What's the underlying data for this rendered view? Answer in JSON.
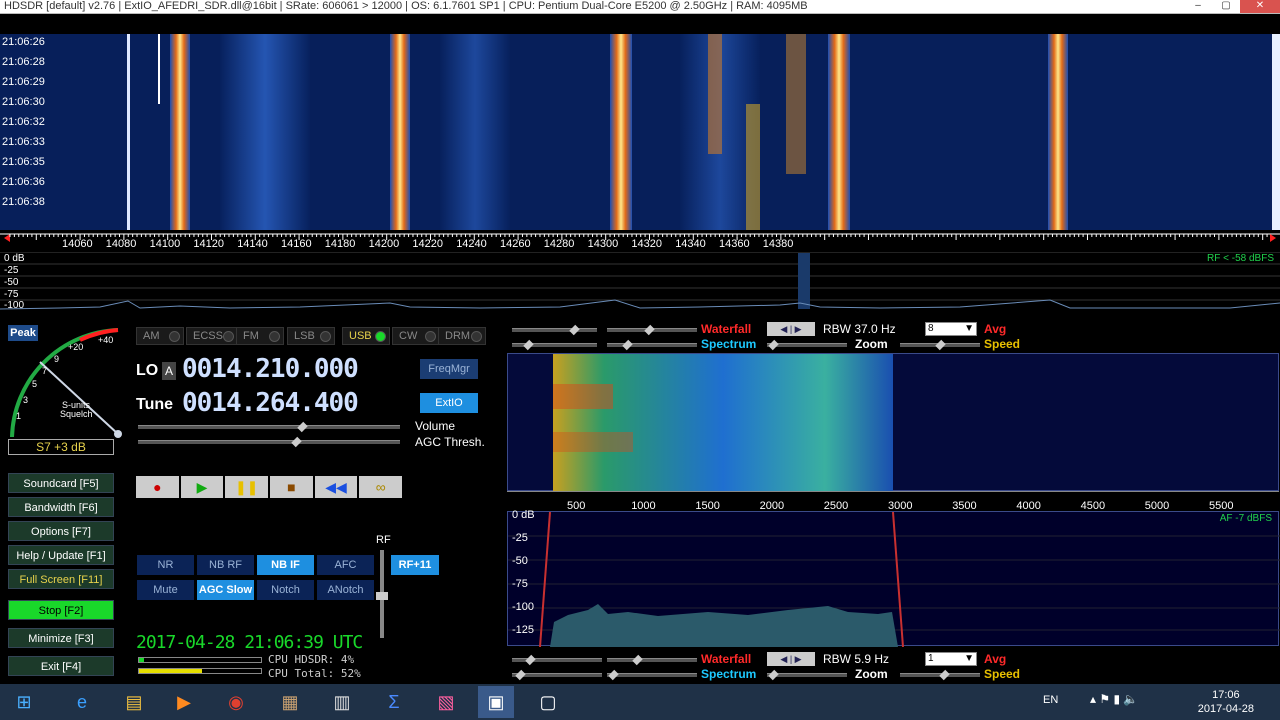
{
  "titlebar": {
    "text": "HDSDR  [default]  v2.76    |   ExtIO_AFEDRI_SDR.dll@16bit   |  SRate: 606061 > 12000   |  OS: 6.1.7601 SP1   |  CPU: Pentium Dual-Core          E5200  @ 2.50GHz  |  RAM: 4095MB",
    "min": "–",
    "max": "▢",
    "close": "✕"
  },
  "times": [
    "21:06:26",
    "21:06:28",
    "21:06:29",
    "21:06:30",
    "21:06:32",
    "21:06:33",
    "21:06:35",
    "21:06:36",
    "21:06:38"
  ],
  "freqs": [
    "14060",
    "14080",
    "14100",
    "14120",
    "14140",
    "14160",
    "14180",
    "14200",
    "14220",
    "14240",
    "14260",
    "14280",
    "14300",
    "14320",
    "14340",
    "14360",
    "14380"
  ],
  "spectrum": {
    "db": [
      "0 dB",
      "-25",
      "-50",
      "-75",
      "-100"
    ],
    "rf_level": "RF < -58 dBFS"
  },
  "meter": {
    "peak": "Peak",
    "reading": "S7 +3 dB",
    "marks": [
      "+40",
      "+20",
      "9",
      "7",
      "5",
      "3",
      "1"
    ],
    "label1": "S-units",
    "label2": "Squelch"
  },
  "modes": [
    {
      "l": "AM",
      "on": false
    },
    {
      "l": "ECSS",
      "on": false
    },
    {
      "l": "FM",
      "on": false
    },
    {
      "l": "LSB",
      "on": false
    },
    {
      "l": "USB",
      "on": true
    },
    {
      "l": "CW",
      "on": false
    },
    {
      "l": "DRM",
      "on": false
    }
  ],
  "lo": {
    "label": "LO",
    "a": "A",
    "value": "0014.210.000"
  },
  "tune": {
    "label": "Tune",
    "value": "0014.264.400"
  },
  "freqmgr": "FreqMgr",
  "extio": "ExtIO",
  "volume": "Volume",
  "agcthresh": "AGC Thresh.",
  "sidebtns": [
    {
      "l": "Soundcard  [F5]"
    },
    {
      "l": "Bandwidth  [F6]"
    },
    {
      "l": "Options  [F7]"
    },
    {
      "l": "Help / Update  [F1]"
    },
    {
      "l": "Full Screen  [F11]"
    },
    {
      "l": "Stop          [F2]"
    },
    {
      "l": "Minimize  [F3]"
    },
    {
      "l": "Exit       [F4]"
    }
  ],
  "dsp1": [
    {
      "l": "NR",
      "on": false
    },
    {
      "l": "NB RF",
      "on": false
    },
    {
      "l": "NB IF",
      "on": true
    },
    {
      "l": "AFC",
      "on": false
    }
  ],
  "dsp2": [
    {
      "l": "Mute",
      "on": false
    },
    {
      "l": "AGC Slow",
      "on": true
    },
    {
      "l": "Notch",
      "on": false
    },
    {
      "l": "ANotch",
      "on": false
    }
  ],
  "rf": "RF",
  "rfbtn": "RF+11",
  "datetime": "2017-04-28   21:06:39 UTC",
  "cpu1": "CPU HDSDR:  4%",
  "cpu2": "CPU Total: 52%",
  "top": {
    "waterfall": "Waterfall",
    "spectrum": "Spectrum",
    "rbw": "RBW 37.0 Hz",
    "zoom": "Zoom",
    "sel": "8",
    "avg": "Avg",
    "speed": "Speed"
  },
  "bottom": {
    "waterfall": "Waterfall",
    "spectrum": "Spectrum",
    "rbw": "RBW  5.9 Hz",
    "zoom": "Zoom",
    "sel": "1",
    "avg": "Avg",
    "speed": "Speed"
  },
  "afscale": [
    "500",
    "1000",
    "1500",
    "2000",
    "2500",
    "3000",
    "3500",
    "4000",
    "4500",
    "5000",
    "5500"
  ],
  "afdb": [
    "0 dB",
    "-25",
    "-50",
    "-75",
    "-100",
    "-125"
  ],
  "af_level": "AF -7 dBFS",
  "clock": {
    "time": "17:06",
    "date": "2017-04-28",
    "lang": "EN"
  }
}
